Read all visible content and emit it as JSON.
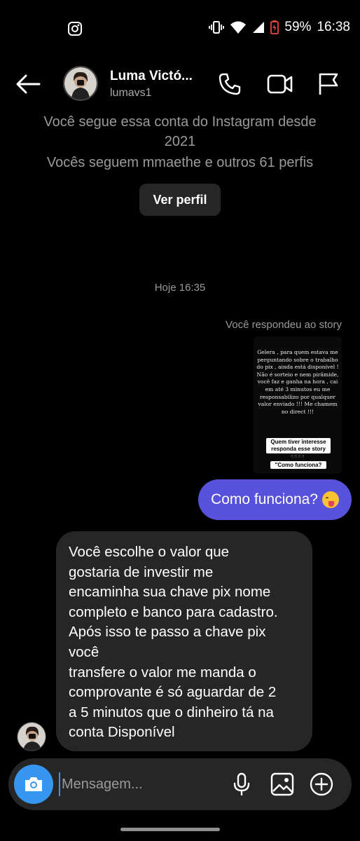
{
  "status_bar": {
    "battery": "59%",
    "time": "16:38"
  },
  "header": {
    "name": "Luma Victó...",
    "handle": "lumavs1"
  },
  "profile_info": {
    "line1": "Você segue essa conta do Instagram desde",
    "line2": "2021",
    "line3": "Vocês seguem mmaethe e outros 61 perfis",
    "view_profile_label": "Ver perfil"
  },
  "conversation": {
    "timestamp": "Hoje 16:35",
    "story_reply_label": "Você respondeu ao story",
    "story": {
      "text": "Gelera , para quem estava me perguntando sobre o trabalho do pix , ainda está disponível ! Não é sorteio e nem pirâmide, você faz e ganha na hora , cai em até 3 minutos eu me responsabilizo por qualquer valor enviado !!! Me chamem no direct !!!",
      "sticker": "Quem tiver interesse responda esse story",
      "question": "\"Como funciona?"
    },
    "outgoing_message": "Como funciona?",
    "incoming_message": "Você escolhe o valor que\ngostaria de investir me\nencaminha sua chave pix nome\ncompleto e banco para cadastro.\nApós isso te passo a chave pix\nvocê\ntransfere o valor me manda o\ncomprovante é só aguardar de 2\na 5 minutos que o dinheiro tá na\nconta Disponível"
  },
  "composer": {
    "placeholder": "Mensagem..."
  },
  "colors": {
    "background": "#000000",
    "outgoing_bubble": "#5851db",
    "incoming_bubble": "#262626",
    "accent": "#3797f0"
  },
  "icons": {
    "back": "arrow-left-icon",
    "phone": "phone-icon",
    "video": "video-camera-icon",
    "flag": "flag-icon",
    "camera": "camera-icon",
    "mic": "microphone-icon",
    "gallery": "image-icon",
    "plus": "plus-circle-icon"
  }
}
